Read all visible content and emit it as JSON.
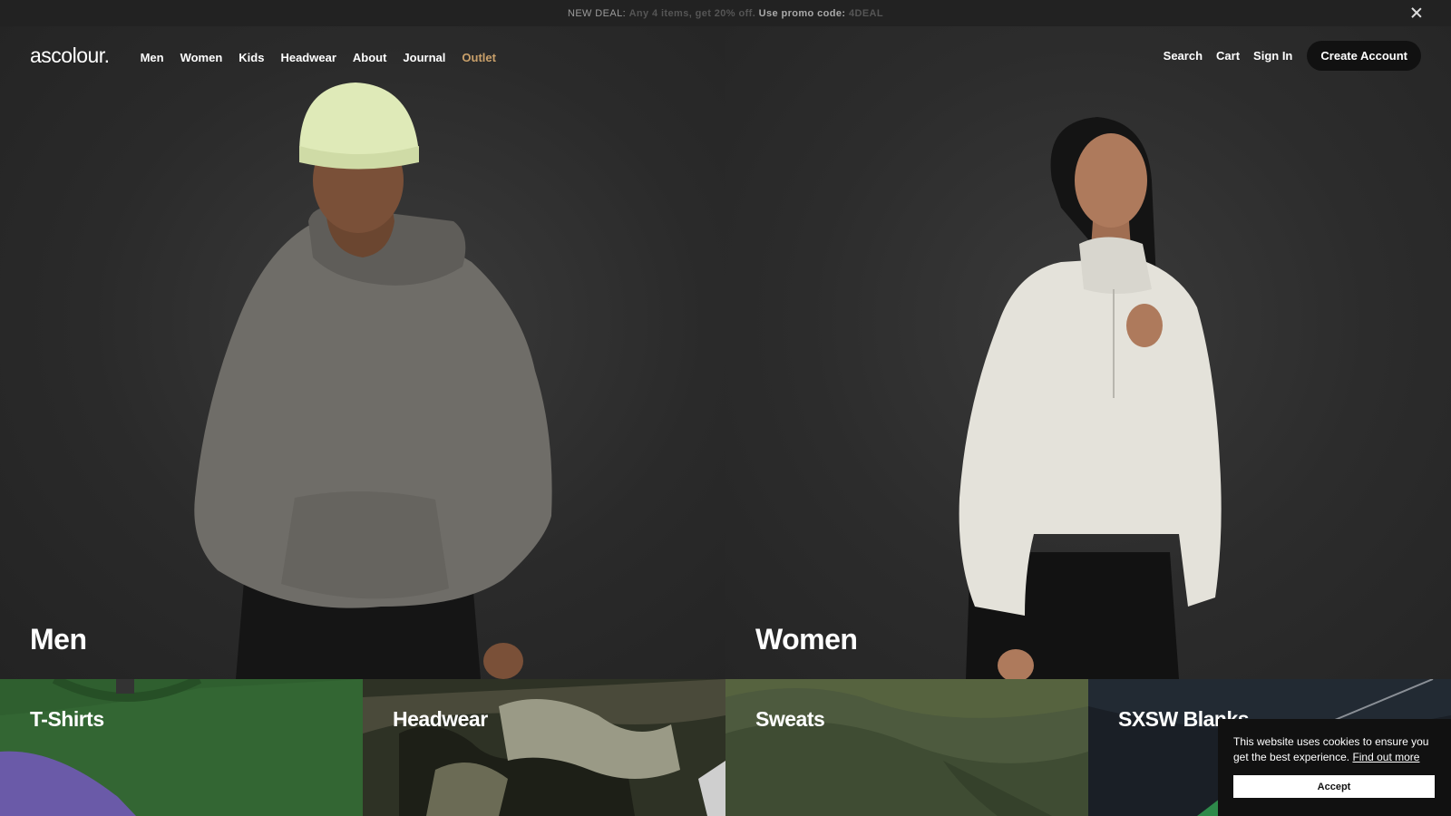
{
  "promo": {
    "lead": "NEW DEAL:",
    "offer": "Any 4 items, get 20% off.",
    "use_code": "Use promo code:",
    "code": "4DEAL"
  },
  "header": {
    "logo": "ascolour.",
    "nav": [
      "Men",
      "Women",
      "Kids",
      "Headwear",
      "About",
      "Journal",
      "Outlet"
    ],
    "search": "Search",
    "cart": "Cart",
    "sign_in": "Sign In",
    "create_account": "Create Account"
  },
  "hero": {
    "left_title": "Men",
    "right_title": "Women"
  },
  "categories": [
    "T-Shirts",
    "Headwear",
    "Sweats",
    "SXSW Blanks"
  ],
  "cookie": {
    "message": "This website uses cookies to ensure you get the best experience.",
    "link": "Find out more",
    "accept": "Accept"
  },
  "colors": {
    "outlet": "#c9a06a",
    "promo_bg": "#222222",
    "hero_bg": "#2a2a2a"
  }
}
